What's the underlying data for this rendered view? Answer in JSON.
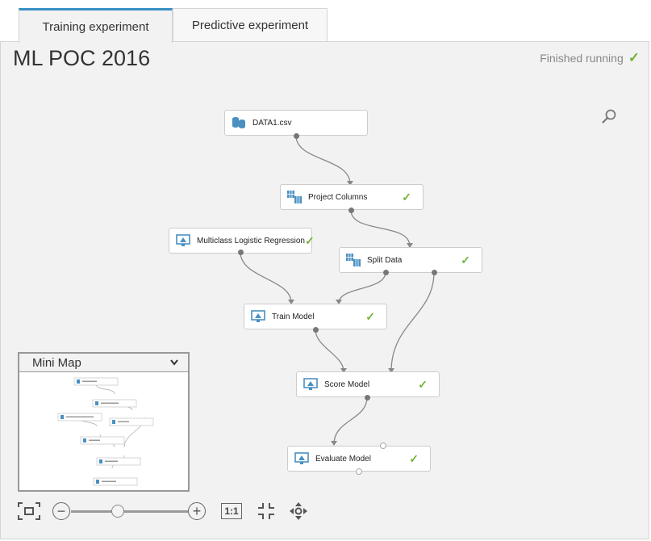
{
  "tabs": [
    {
      "label": "Training experiment",
      "active": true
    },
    {
      "label": "Predictive experiment",
      "active": false
    }
  ],
  "experiment": {
    "title": "ML POC 2016",
    "status": "Finished running",
    "status_icon": "check-icon",
    "status_color": "#6fb536"
  },
  "nodes": {
    "data1": {
      "label": "DATA1.csv",
      "icon": "dataset-icon"
    },
    "project_columns": {
      "label": "Project Columns",
      "icon": "module-icon",
      "done": "✓"
    },
    "multiclass": {
      "label": "Multiclass Logistic Regression",
      "icon": "model-icon",
      "done": "✓"
    },
    "split_data": {
      "label": "Split Data",
      "icon": "module-icon",
      "done": "✓"
    },
    "train_model": {
      "label": "Train Model",
      "icon": "model-icon",
      "done": "✓"
    },
    "score_model": {
      "label": "Score Model",
      "icon": "model-icon",
      "done": "✓"
    },
    "evaluate_model": {
      "label": "Evaluate Model",
      "icon": "model-icon",
      "done": "✓"
    }
  },
  "minimap": {
    "title": "Mini Map",
    "toggle_icon": "chevron-down-icon"
  },
  "zoom": {
    "minus": "−",
    "plus": "+",
    "actual_size": "1:1",
    "level": 0.4
  },
  "accent_color": "#3a8fc4"
}
